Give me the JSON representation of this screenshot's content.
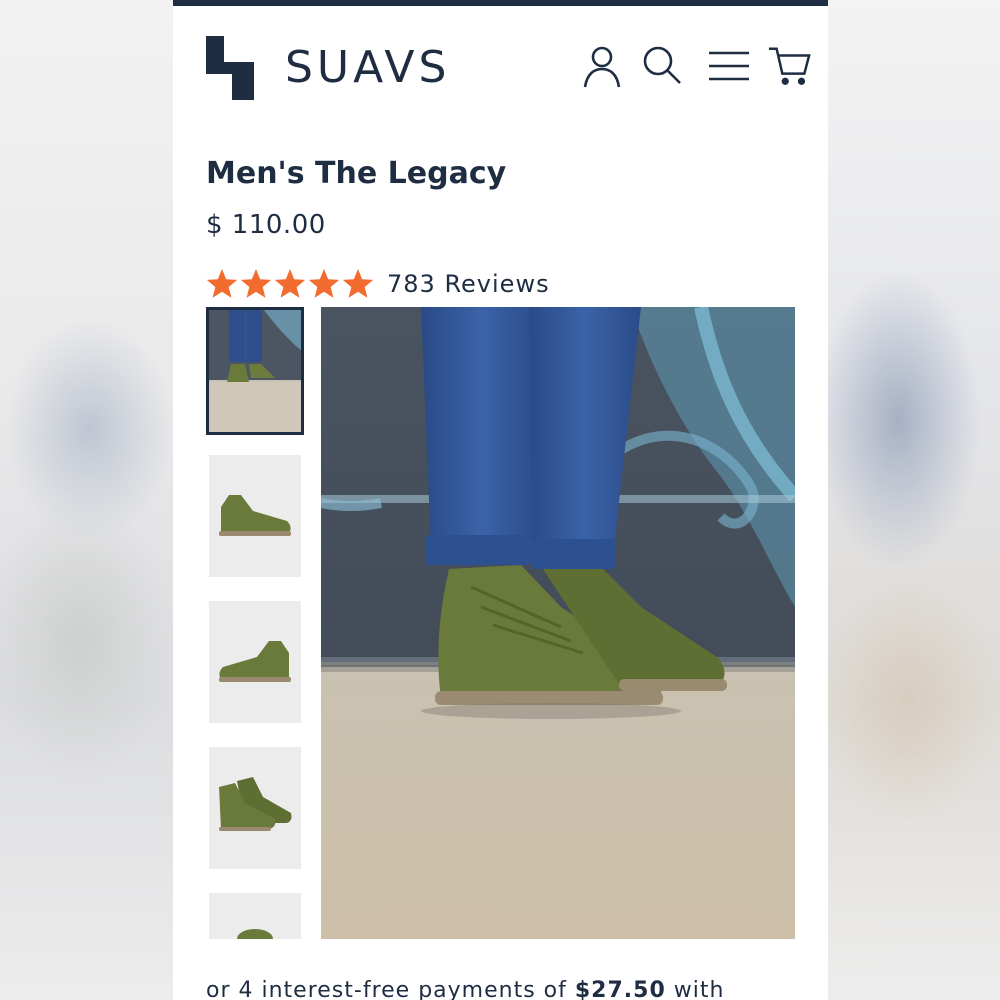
{
  "brand": {
    "name": "SUAVS",
    "logo_icon": "suavs-logo-icon"
  },
  "header_icons": [
    "account-icon",
    "search-icon",
    "menu-icon",
    "cart-icon"
  ],
  "product": {
    "title": "Men's The Legacy",
    "price": "$ 110.00",
    "rating": 5,
    "reviews": "783 Reviews"
  },
  "gallery": {
    "thumbnail_count": 5,
    "active_thumbnail": 1
  },
  "installments": {
    "prefix": "or 4 interest-free payments of ",
    "amount": "$27.50",
    "suffix": " with"
  },
  "colors": {
    "brand_navy": "#1f2d42",
    "star_orange": "#f26b2f",
    "shoe_green": "#6a7a3a"
  }
}
